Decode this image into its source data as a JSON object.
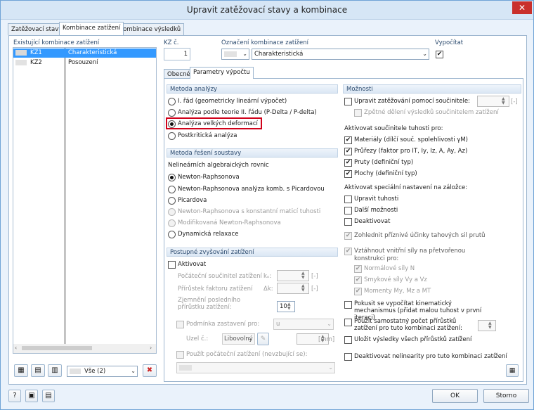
{
  "window": {
    "title": "Upravit zatěžovací stavy a kombinace",
    "close": "✕"
  },
  "tabs": [
    "Zatěžovací stavy",
    "Kombinace zatížení",
    "Kombinace výsledků"
  ],
  "left": {
    "header": "Existující kombinace zatížení",
    "rows": [
      {
        "id": "KZ1",
        "name": "Charakteristická"
      },
      {
        "id": "KZ2",
        "name": "Posouzení"
      }
    ],
    "filter": "Vše (2)"
  },
  "top": {
    "kz_label": "KZ č.",
    "kz_value": "1",
    "oznaceni_label": "Označení kombinace zatížení",
    "oznaceni_value": "Charakteristická",
    "vypocitat_label": "Vypočítat",
    "vypocitat_check": "✔"
  },
  "subtabs": [
    "Obecné",
    "Parametry výpočtu"
  ],
  "metoda_analyzy": {
    "title": "Metoda analýzy",
    "options": [
      "I. řád (geometricky lineární výpočet)",
      "Analýza podle teorie II. řádu (P-Delta / P-delta)",
      "Analýza velkých deformací",
      "Postkritická analýza"
    ]
  },
  "metoda_reseni": {
    "title": "Metoda řešení soustavy",
    "sub": "Nelineárních algebraických rovnic",
    "options": [
      "Newton-Raphsonova",
      "Newton-Raphsonova analýza komb. s Picardovou",
      "Picardova",
      "Newton-Raphsonova s konstantní maticí tuhosti",
      "Modifikovaná Newton-Raphsonova",
      "Dynamická relaxace"
    ]
  },
  "postupne": {
    "title": "Postupné zvyšování zatížení",
    "aktivovat": "Aktivovat",
    "pocatecni": "Počáteční součinitel zatížení",
    "pocatecni_sym": "kₒ:",
    "pocatecni_unit": "[-]",
    "prirustek": "Přírůstek faktoru zatížení",
    "prirustek_sym": "Δk:",
    "prirustek_unit": "[-]",
    "zjemneni": "Zjemnění posledního přírůstku zatížení:",
    "zjemneni_value": "10",
    "podminka": "Podmínka zastavení pro:",
    "podminka_value": "u",
    "uzel": "Uzel č.:",
    "libovolny": "Libovolný",
    "mm": "[mm]",
    "pouzit": "Použít počáteční zatížení (nevzbující se):"
  },
  "moznosti": {
    "title": "Možnosti",
    "upravit": "Upravit zatěžování pomocí součinitele:",
    "upravit_unit": "[-]",
    "zpetne": "Zpětné dělení výsledků součinitelem zatížení",
    "aktivovat_tuhosti": "Aktivovat součinitele tuhosti pro:",
    "materialy": "Materiály (dílčí souč. spolehlivosti γM)",
    "prurezy": "Průřezy (faktor pro IT, Iy, Iz, A, Ay, Az)",
    "pruty": "Pruty (definiční typ)",
    "plochy": "Plochy (definiční typ)",
    "specialni": "Aktivovat speciální nastavení na záložce:",
    "upravit_tuhosti": "Upravit tuhosti",
    "dalsi": "Další možnosti",
    "deaktivovat": "Deaktivovat",
    "zohlednit": "Zohlednit příznivé účinky tahových sil prutů",
    "vztahnout": "Vztáhnout vnitřní síly na přetvořenou konstrukci pro:",
    "normalove": "Normálové síly N",
    "smykove": "Smykové síly Vy a Vz",
    "momenty": "Momenty My, Mz a MT",
    "pokusit": "Pokusit se vypočítat kinematický mechanismus (přidat malou tuhost v první iteraci)",
    "pouzit_samostatny": "Použít samostatný počet přírůstků zatížení pro tuto kombinaci zatížení:",
    "ulozit": "Uložit výsledky všech přírůstků zatížení",
    "deaktivovat_nelinearity": "Deaktivovat nelinearity pro tuto kombinaci zatížení"
  },
  "buttons": {
    "ok": "OK",
    "storno": "Storno"
  },
  "colors": {
    "accent": "#3399ff",
    "highlight_border": "#d0021b"
  }
}
